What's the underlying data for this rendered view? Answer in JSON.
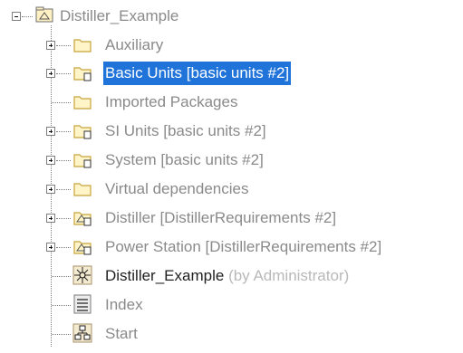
{
  "tree": {
    "root": {
      "label": "Distiller_Example",
      "icon": "package-icon"
    },
    "items": [
      {
        "label": "Auxiliary",
        "icon": "folder-icon",
        "expandable": true
      },
      {
        "label": "Basic Units [basic units #2]",
        "icon": "shared-package-icon",
        "expandable": true,
        "selected": true
      },
      {
        "label": "Imported Packages",
        "icon": "folder-icon",
        "expandable": false
      },
      {
        "label": "SI Units [basic units #2]",
        "icon": "shared-package-icon",
        "expandable": true
      },
      {
        "label": "System [basic units #2]",
        "icon": "shared-package-icon",
        "expandable": true
      },
      {
        "label": "Virtual dependencies",
        "icon": "folder-icon",
        "expandable": true
      },
      {
        "label": "Distiller [DistillerRequirements #2]",
        "icon": "shared-model-icon",
        "expandable": true
      },
      {
        "label": "Power Station [DistillerRequirements #2]",
        "icon": "shared-model-icon",
        "expandable": true
      },
      {
        "label": "Distiller_Example",
        "suffix": "(by Administrator)",
        "icon": "diagram-icon",
        "expandable": false
      },
      {
        "label": "Index",
        "icon": "document-icon",
        "expandable": false
      },
      {
        "label": "Start",
        "icon": "hierarchy-icon",
        "expandable": false
      }
    ]
  },
  "colors": {
    "selection": "#1f73d9",
    "text": "#8a8a8a",
    "text_dark": "#1f1f1f",
    "suffix": "#b9b9b9",
    "folder_fill": "#fff5c8",
    "folder_stroke": "#c7a33b"
  }
}
